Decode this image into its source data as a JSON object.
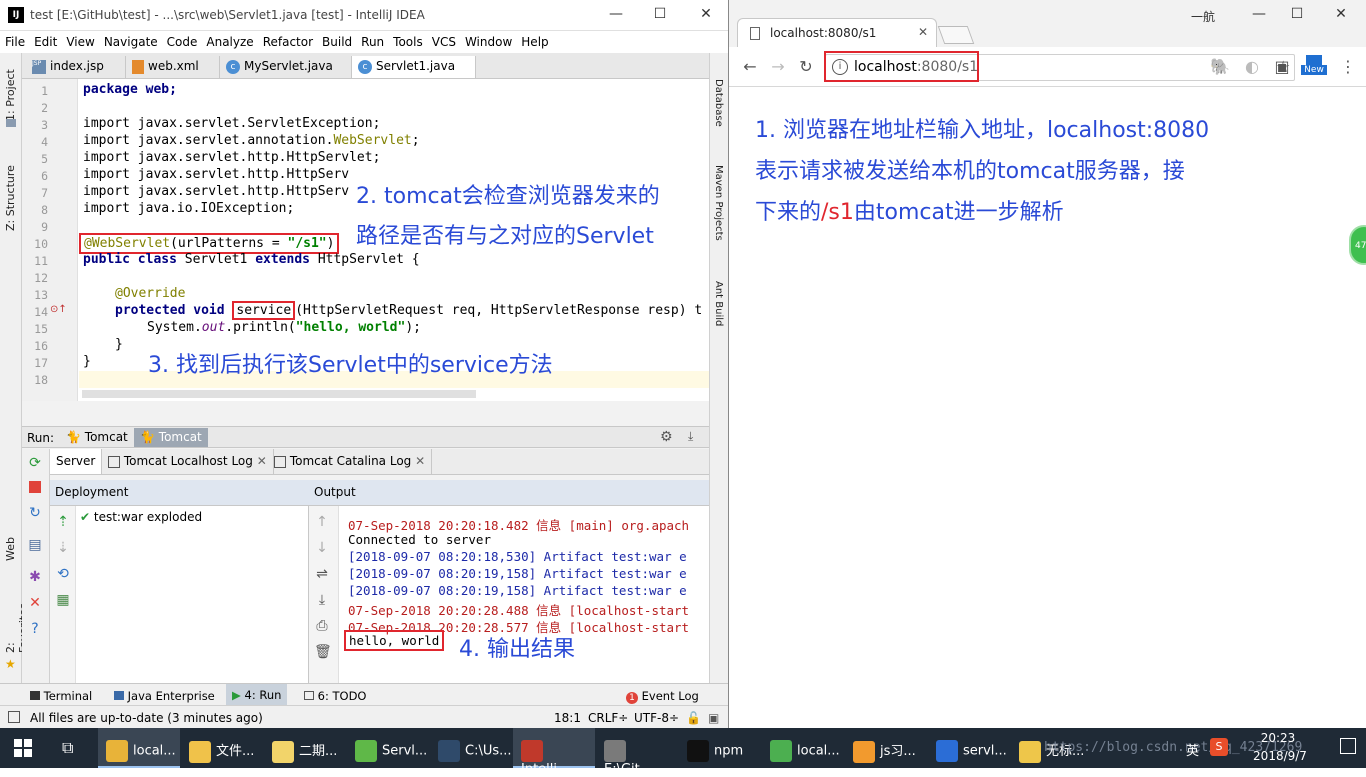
{
  "ide": {
    "window_title": "test [E:\\GitHub\\test] - ...\\src\\web\\Servlet1.java [test] - IntelliJ IDEA",
    "menu": [
      "File",
      "Edit",
      "View",
      "Navigate",
      "Code",
      "Analyze",
      "Refactor",
      "Build",
      "Run",
      "Tools",
      "VCS",
      "Window",
      "Help"
    ],
    "left_tools": [
      "1: Project",
      "Z: Structure",
      "Web",
      "2: Favorites"
    ],
    "right_tools": [
      "Database",
      "Maven Projects",
      "Ant Build"
    ],
    "tabs": [
      {
        "label": "index.jsp",
        "icon": "jsp-file-icon",
        "active": false
      },
      {
        "label": "web.xml",
        "icon": "xml-file-icon",
        "active": false
      },
      {
        "label": "MyServlet.java",
        "icon": "java-class-icon",
        "active": false
      },
      {
        "label": "Servlet1.java",
        "icon": "java-class-icon",
        "active": true
      }
    ],
    "line_numbers": [
      "1",
      "2",
      "3",
      "4",
      "5",
      "6",
      "7",
      "8",
      "9",
      "10",
      "11",
      "12",
      "13",
      "14",
      "15",
      "16",
      "17",
      "18"
    ],
    "code": {
      "l1": "package web;",
      "l3": "import javax.servlet.ServletException;",
      "l4a": "import javax.servlet.annotation.",
      "l4b": "WebServlet",
      "l4c": ";",
      "l5": "import javax.servlet.http.HttpServlet;",
      "l6": "import javax.servlet.http.HttpServ",
      "l7": "import javax.servlet.http.HttpServ",
      "l8": "import java.io.IOException;",
      "l10a": "@WebServlet",
      "l10b": "(urlPatterns = ",
      "l10c": "\"/s1\"",
      "l10d": ")",
      "l11a": "public class",
      "l11b": " Servlet1 ",
      "l11c": "extends",
      "l11d": " HttpServlet {",
      "l13": "@Override",
      "l14a": "protected void",
      "l14b": "service",
      "l14c": "(HttpServletRequest req, HttpServletResponse resp) t",
      "l15a": "System.",
      "l15b": "out",
      "l15c": ".println(",
      "l15d": "\"hello, world\"",
      "l15e": ");",
      "l16": "}",
      "l17": "}"
    },
    "annotation_2_line1": "2. tomcat会检查浏览器发来的",
    "annotation_2_line2": "路径是否有与之对应的Servlet",
    "annotation_3": "3. 找到后执行该Servlet中的service方法",
    "run": {
      "label": "Run:",
      "tabs": [
        "Tomcat",
        "Tomcat"
      ],
      "subtabs": [
        "Server",
        "Tomcat Localhost Log",
        "Tomcat Catalina Log"
      ],
      "deployment_header": "Deployment",
      "deployment_item": "test:war exploded",
      "output_header": "Output",
      "output_lines": [
        {
          "text": "07-Sep-2018 20:20:18.482 信息 [main] org.apach",
          "cls": "red"
        },
        {
          "text": "Connected to server",
          "cls": ""
        },
        {
          "text": "[2018-09-07 08:20:18,530] Artifact test:war e",
          "cls": "blue"
        },
        {
          "text": "[2018-09-07 08:20:19,158] Artifact test:war e",
          "cls": "blue"
        },
        {
          "text": "[2018-09-07 08:20:19,158] Artifact test:war e",
          "cls": "blue"
        },
        {
          "text": "07-Sep-2018 20:20:28.488 信息 [localhost-start",
          "cls": "red"
        },
        {
          "text": "07-Sep-2018 20:20:28.577 信息 [localhost-start",
          "cls": "red"
        }
      ],
      "output_hello": "hello, world",
      "annotation_4": "4. 输出结果"
    },
    "bottom_tabs": [
      "Terminal",
      "Java Enterprise",
      "4: Run",
      "6: TODO"
    ],
    "event_log": "Event Log",
    "status_text": "All files are up-to-date (3 minutes ago)",
    "status_pos": "18:1",
    "status_crlf": "CRLF÷",
    "status_enc": "UTF-8÷"
  },
  "browser": {
    "tab_title": "localhost:8080/s1",
    "address_host": "localhost",
    "address_rest": ":8080/s1",
    "window_user": "一航",
    "badge_new": "New",
    "side_badge": "47",
    "content_line1": "1. 浏览器在地址栏输入地址，localhost:8080",
    "content_line2": "表示请求被发送给本机的tomcat服务器，接",
    "content_line3a": "下来的",
    "content_line3b": "/s1",
    "content_line3c": "由tomcat进一步解析"
  },
  "taskbar": {
    "items": [
      "local...",
      "文件...",
      "二期...",
      "Servl...",
      "C:\\Us...",
      "Intelli...",
      "E:\\Git...",
      "npm",
      "local...",
      "js习...",
      "servl...",
      "无标..."
    ],
    "ime": "英",
    "time": "20:23",
    "date": "2018/9/7",
    "watermark": "https://blog.csdn.net/qq_42371269"
  },
  "colors": {
    "annotation": "#2a4ad6",
    "highlight_box": "#e0262e",
    "ide_keyword": "#000080",
    "ide_string": "#008000"
  }
}
